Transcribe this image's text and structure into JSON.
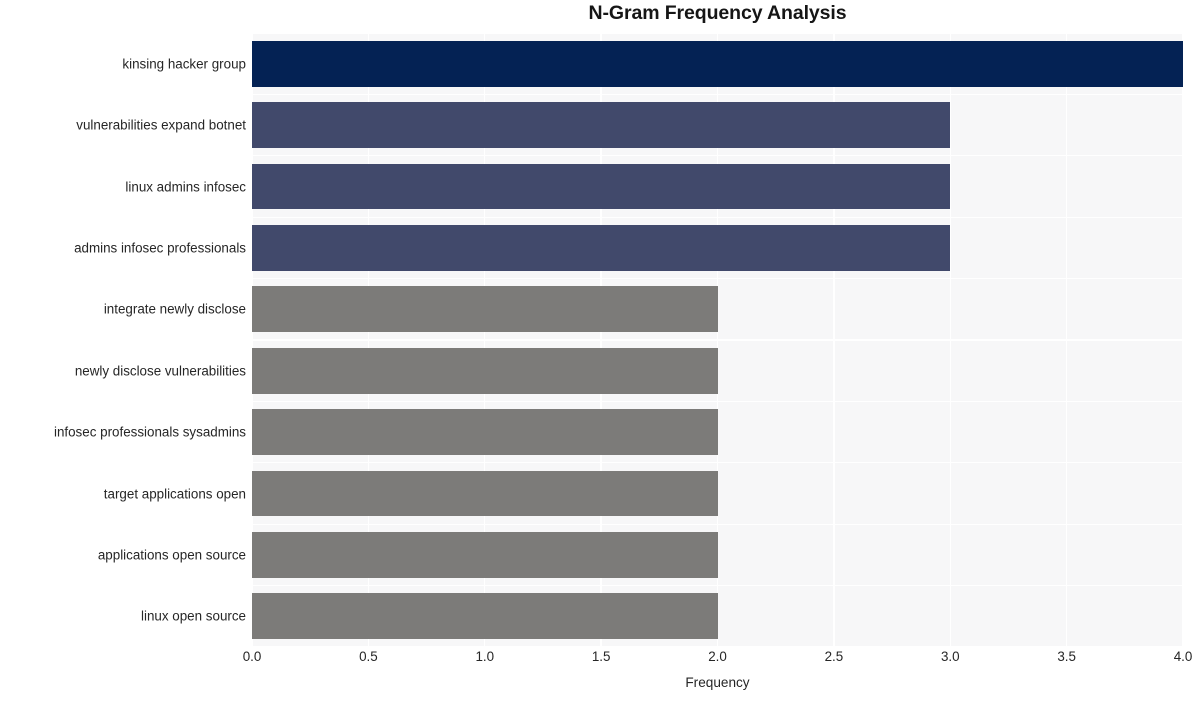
{
  "chart_data": {
    "type": "bar",
    "orientation": "horizontal",
    "title": "N-Gram Frequency Analysis",
    "xlabel": "Frequency",
    "ylabel": "",
    "xlim": [
      0.0,
      4.0
    ],
    "xticks": [
      "0.0",
      "0.5",
      "1.0",
      "1.5",
      "2.0",
      "2.5",
      "3.0",
      "3.5",
      "4.0"
    ],
    "xtick_values": [
      0.0,
      0.5,
      1.0,
      1.5,
      2.0,
      2.5,
      3.0,
      3.5,
      4.0
    ],
    "grid": true,
    "legend": "none",
    "categories": [
      "kinsing hacker group",
      "vulnerabilities expand botnet",
      "linux admins infosec",
      "admins infosec professionals",
      "integrate newly disclose",
      "newly disclose vulnerabilities",
      "infosec professionals sysadmins",
      "target applications open",
      "applications open source",
      "linux open source"
    ],
    "values": [
      4,
      3,
      3,
      3,
      2,
      2,
      2,
      2,
      2,
      2
    ],
    "bar_colors": [
      "#042254",
      "#41496b",
      "#41496b",
      "#41496b",
      "#7c7b79",
      "#7c7b79",
      "#7c7b79",
      "#7c7b79",
      "#7c7b79",
      "#7c7b79"
    ],
    "plot_background": "#f7f7f8",
    "figure_background": "#ffffff",
    "grid_color": "#ffffff"
  }
}
